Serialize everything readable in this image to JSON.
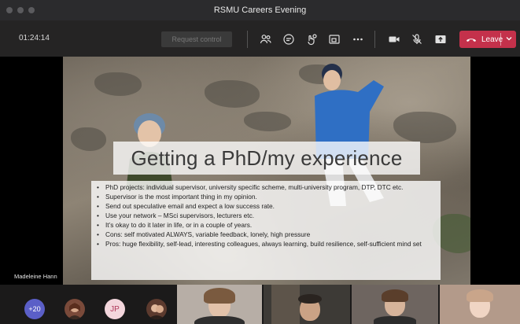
{
  "window": {
    "title": "RSMU Careers Evening"
  },
  "toolbar": {
    "timer": "01:24:14",
    "request_control_label": "Request control",
    "leave_label": "Leave",
    "icons": [
      "participants-icon",
      "chat-icon",
      "reactions-icon",
      "rooms-icon",
      "more-icon",
      "camera-icon",
      "mic-muted-icon",
      "share-icon"
    ],
    "colors": {
      "leave": "#c4314b",
      "toolbar": "#252424"
    }
  },
  "slide": {
    "title": "Getting a PhD/my experience",
    "bullets": [
      "PhD projects: individual supervisor, university specific scheme, multi-university program, DTP, DTC etc.",
      "Supervisor is the most important thing in my opinion.",
      "Send out speculative email and expect a low success rate.",
      "Use your network – MSci supervisors, lecturers etc.",
      "It’s okay to do it later in life, or in a couple of years.",
      "Cons: self motivated ALWAYS, variable feedback, lonely, high pressure",
      "Pros: huge flexibility, self-lead, interesting colleagues, always learning, build resilience, self-sufficient mind set"
    ]
  },
  "presenter": {
    "name": "Madeleine Hann"
  },
  "participants": {
    "more_count": "+20",
    "initials": "JP",
    "colors": {
      "more": "#5b5fc7",
      "initials_bg": "#f3d6dc"
    }
  }
}
